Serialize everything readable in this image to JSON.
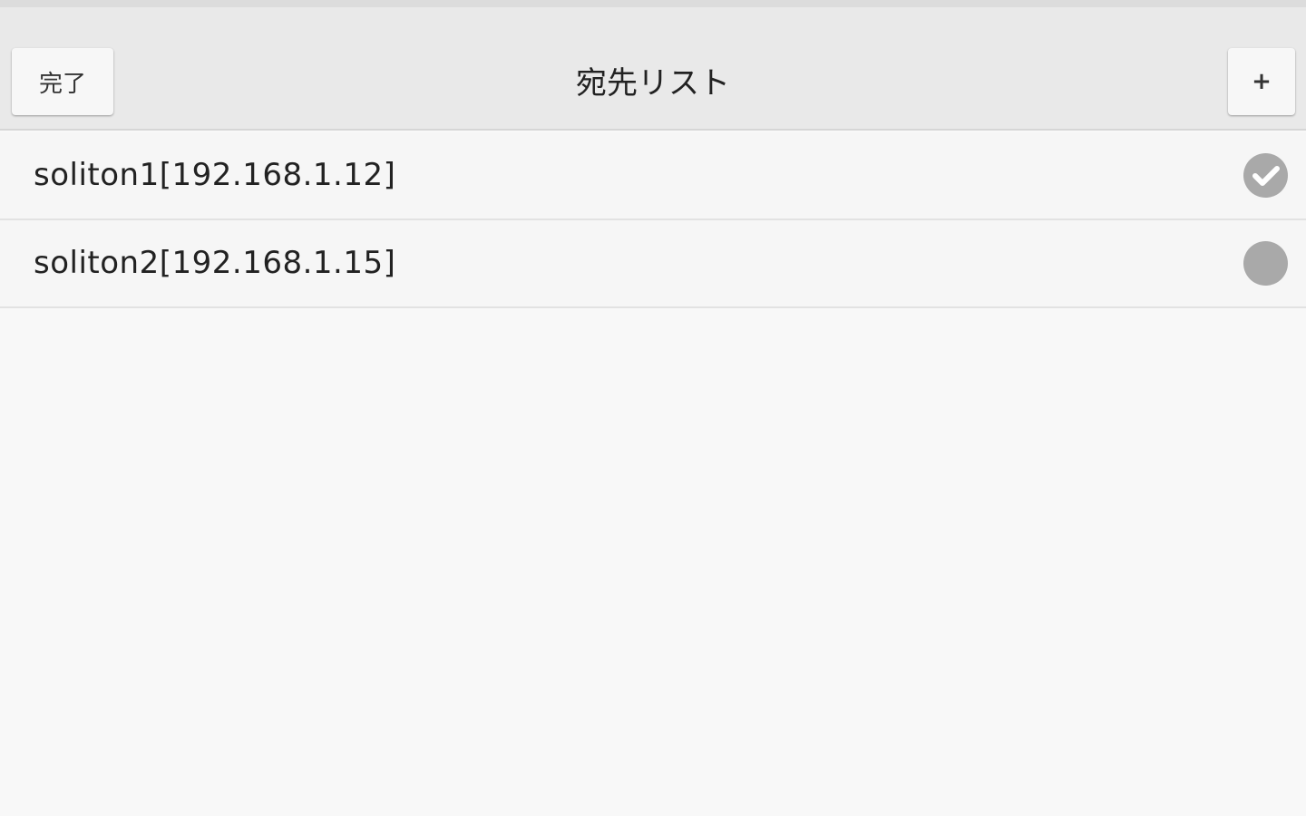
{
  "header": {
    "done_label": "完了",
    "title": "宛先リスト",
    "add_label": "+"
  },
  "destinations": [
    {
      "label": "soliton1[192.168.1.12]",
      "selected": true
    },
    {
      "label": "soliton2[192.168.1.15]",
      "selected": false
    }
  ],
  "colors": {
    "header_bg": "#e9e9e9",
    "list_bg": "#f8f8f8",
    "indicator": "#a9a9a9"
  },
  "icons": {
    "selected": "check-circle-icon",
    "unselected": "circle-icon"
  }
}
